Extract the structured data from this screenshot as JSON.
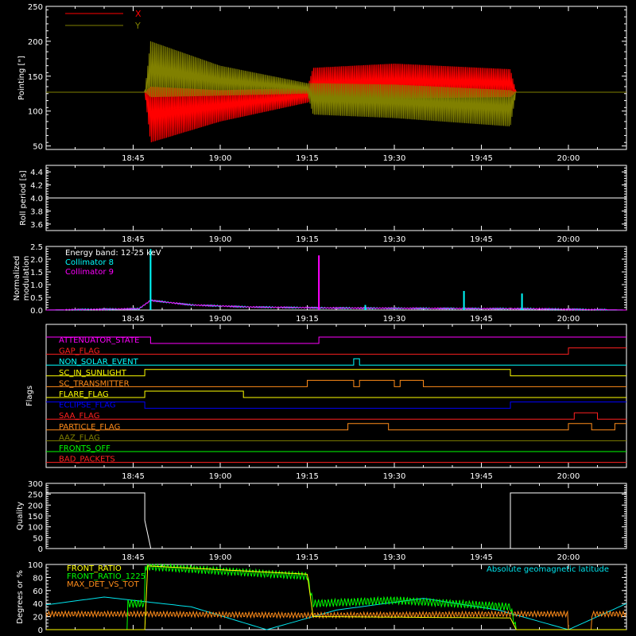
{
  "colors": {
    "bg": "#000000",
    "axis": "#ffffff",
    "x_series": "#ff0000",
    "y_series": "#808000",
    "cyan": "#00ffff",
    "magenta": "#ff00ff",
    "green": "#00ff00",
    "orange": "#ff8c1a",
    "yellow": "#ffff00",
    "blue": "#0000ff",
    "red": "#ff0000"
  },
  "time_axis": {
    "range_min": [
      "18:30",
      "20:10"
    ],
    "ticks": [
      "18:45",
      "19:00",
      "19:15",
      "19:30",
      "19:45",
      "20:00"
    ]
  },
  "chart_data": [
    {
      "id": "pointing",
      "type": "line",
      "ylabel": "Pointing [\"]",
      "ylim": [
        45,
        250
      ],
      "yticks": [
        "50",
        "100",
        "150",
        "200",
        "250"
      ],
      "legend": [
        "X",
        "Y"
      ],
      "series": [
        {
          "name": "X",
          "envelope_x": [
            "18:30",
            "18:47",
            "18:48",
            "19:00",
            "19:15",
            "19:16",
            "19:30",
            "19:50",
            "19:51",
            "20:10"
          ],
          "low": [
            127,
            127,
            55,
            85,
            112,
            115,
            118,
            120,
            127,
            127
          ],
          "high": [
            127,
            127,
            135,
            130,
            133,
            162,
            168,
            160,
            127,
            127
          ]
        },
        {
          "name": "Y",
          "envelope_x": [
            "18:30",
            "18:47",
            "18:48",
            "19:00",
            "19:15",
            "19:16",
            "19:30",
            "19:50",
            "19:51",
            "20:10"
          ],
          "low": [
            127,
            127,
            120,
            122,
            125,
            95,
            90,
            78,
            127,
            127
          ],
          "high": [
            127,
            127,
            200,
            165,
            140,
            140,
            138,
            130,
            127,
            127
          ]
        }
      ]
    },
    {
      "id": "roll",
      "type": "line",
      "ylabel": "Roll period [s]",
      "ylim": [
        3.5,
        4.5
      ],
      "yticks": [
        "3.6",
        "3.8",
        "4.0",
        "4.2",
        "4.4"
      ],
      "series": [
        {
          "name": "",
          "x": [
            "18:30",
            "20:10"
          ],
          "y": [
            4.0,
            4.0
          ]
        }
      ]
    },
    {
      "id": "modulation",
      "type": "line",
      "ylabel": "Normalized modulation",
      "ylim": [
        0,
        2.5
      ],
      "yticks": [
        "0.0",
        "0.5",
        "1.0",
        "1.5",
        "2.0",
        "2.5"
      ],
      "legend": [
        "Energy band: 12-25 keV",
        "Collimator 8",
        "Collimator 9"
      ],
      "baseline": {
        "x": [
          "18:30",
          "18:46",
          "18:48",
          "18:55",
          "19:05",
          "19:20",
          "19:40",
          "19:53",
          "20:10"
        ],
        "y": [
          0.0,
          0.05,
          0.38,
          0.2,
          0.12,
          0.08,
          0.06,
          0.05,
          0.0
        ]
      },
      "spikes": [
        {
          "x": "18:48",
          "y": 2.4,
          "series": "Collimator 8"
        },
        {
          "x": "19:17",
          "y": 2.15,
          "series": "Collimator 9"
        },
        {
          "x": "19:25",
          "y": 0.2,
          "series": "Collimator 8"
        },
        {
          "x": "19:42",
          "y": 0.75,
          "series": "Collimator 8"
        },
        {
          "x": "19:52",
          "y": 0.65,
          "series": "Collimator 8"
        }
      ]
    },
    {
      "id": "flags",
      "type": "line",
      "ylabel": "Flags",
      "items": [
        {
          "label": "ATTENUATOR_STATE",
          "color": "#ff00ff",
          "x": [
            "18:30",
            "18:48",
            "18:48",
            "19:17",
            "19:17",
            "20:10"
          ],
          "lvl": [
            1,
            1,
            0,
            0,
            1,
            1
          ]
        },
        {
          "label": "GAP_FLAG",
          "color": "#ff2020",
          "x": [
            "18:30",
            "20:00",
            "20:00",
            "20:10"
          ],
          "lvl": [
            0,
            0,
            1,
            1
          ]
        },
        {
          "label": "NON_SOLAR_EVENT",
          "color": "#00ffff",
          "x": [
            "18:30",
            "19:23",
            "19:23",
            "19:24",
            "19:24",
            "20:10"
          ],
          "lvl": [
            0,
            0,
            1,
            1,
            0,
            0
          ]
        },
        {
          "label": "SC_IN_SUNLIGHT",
          "color": "#ffff00",
          "x": [
            "18:30",
            "18:47",
            "18:47",
            "19:50",
            "19:50",
            "20:10"
          ],
          "lvl": [
            0,
            0,
            1,
            1,
            0,
            0
          ]
        },
        {
          "label": "SC_TRANSMITTER",
          "color": "#ff8c1a",
          "x": [
            "18:30",
            "19:15",
            "19:15",
            "19:23",
            "19:23",
            "19:24",
            "19:24",
            "19:30",
            "19:30",
            "19:31",
            "19:31",
            "19:35",
            "19:35",
            "20:10"
          ],
          "lvl": [
            0,
            0,
            1,
            1,
            0,
            0,
            1,
            1,
            0,
            0,
            1,
            1,
            0,
            0
          ]
        },
        {
          "label": "FLARE_FLAG",
          "color": "#ffff00",
          "x": [
            "18:30",
            "18:47",
            "18:47",
            "19:04",
            "19:04",
            "20:10"
          ],
          "lvl": [
            0,
            0,
            1,
            1,
            0,
            0
          ]
        },
        {
          "label": "ECLIPSE_FLAG",
          "color": "#0000ff",
          "x": [
            "18:30",
            "18:47",
            "18:47",
            "19:50",
            "19:50",
            "20:10"
          ],
          "lvl": [
            1,
            1,
            0,
            0,
            1,
            1
          ]
        },
        {
          "label": "SAA_FLAG",
          "color": "#ff2020",
          "x": [
            "18:30",
            "20:01",
            "20:01",
            "20:05",
            "20:05",
            "20:10"
          ],
          "lvl": [
            0,
            0,
            1,
            1,
            0,
            0
          ]
        },
        {
          "label": "PARTICLE_FLAG",
          "color": "#ff8c1a",
          "x": [
            "18:30",
            "19:22",
            "19:22",
            "19:29",
            "19:29",
            "20:00",
            "20:00",
            "20:04",
            "20:04",
            "20:08",
            "20:08",
            "20:10"
          ],
          "lvl": [
            0,
            0,
            1,
            1,
            0,
            0,
            1,
            1,
            0,
            0,
            1,
            1
          ]
        },
        {
          "label": "AAZ_FLAG",
          "color": "#808000",
          "x": [
            "18:30",
            "20:10"
          ],
          "lvl": [
            0,
            0
          ]
        },
        {
          "label": "FRONTS_OFF",
          "color": "#00ff00",
          "x": [
            "18:30",
            "20:10"
          ],
          "lvl": [
            0,
            0
          ]
        },
        {
          "label": "BAD_PACKETS",
          "color": "#ff2020",
          "x": [
            "18:30",
            "20:10"
          ],
          "lvl": [
            0,
            0
          ]
        }
      ]
    },
    {
      "id": "quality",
      "type": "line",
      "ylabel": "Quality",
      "ylim": [
        0,
        300
      ],
      "yticks": [
        "0",
        "50",
        "100",
        "150",
        "200",
        "250",
        "300"
      ],
      "series": [
        {
          "name": "",
          "x": [
            "18:30",
            "18:47",
            "18:47",
            "18:48",
            "18:48",
            "19:50",
            "19:50",
            "20:10"
          ],
          "y": [
            256,
            256,
            130,
            5,
            0,
            0,
            256,
            256
          ]
        }
      ]
    },
    {
      "id": "fronts",
      "type": "line",
      "ylabel": "Degrees or %",
      "ylim": [
        0,
        100
      ],
      "yticks": [
        "0",
        "20",
        "40",
        "60",
        "80",
        "100"
      ],
      "legend": [
        "FRONT_RATIO",
        "FRONT_RATIO_1225",
        "MAX_DET_VS_TOT"
      ],
      "annotation": "Absolute geomagnetic latitude",
      "series": [
        {
          "name": "FRONT_RATIO",
          "color": "#ffff00",
          "x": [
            "18:30",
            "18:47",
            "18:47",
            "19:15",
            "19:16",
            "19:50",
            "19:51",
            "20:10"
          ],
          "y": [
            0,
            0,
            98,
            85,
            20,
            18,
            0,
            0
          ]
        },
        {
          "name": "FRONT_RATIO_1225",
          "color": "#00ff00",
          "x": [
            "18:30",
            "18:44",
            "18:44",
            "18:47",
            "18:47",
            "19:00",
            "19:15",
            "19:16",
            "19:30",
            "19:50",
            "19:51",
            "20:10"
          ],
          "y": [
            0,
            0,
            40,
            40,
            97,
            90,
            82,
            40,
            45,
            35,
            0,
            0
          ]
        },
        {
          "name": "MAX_DET_VS_TOT",
          "color": "#ff8c1a",
          "x": [
            "18:30",
            "18:47",
            "19:15",
            "19:50",
            "20:00",
            "20:00",
            "20:04",
            "20:04",
            "20:10"
          ],
          "y": [
            24,
            24,
            22,
            24,
            24,
            0,
            0,
            24,
            24
          ]
        },
        {
          "name": "Absolute geomagnetic latitude",
          "color": "#00e5ee",
          "x": [
            "18:30",
            "18:40",
            "18:55",
            "19:08",
            "19:20",
            "19:35",
            "19:48",
            "20:00",
            "20:10"
          ],
          "y": [
            38,
            50,
            35,
            0,
            30,
            48,
            30,
            0,
            40
          ]
        }
      ]
    }
  ]
}
